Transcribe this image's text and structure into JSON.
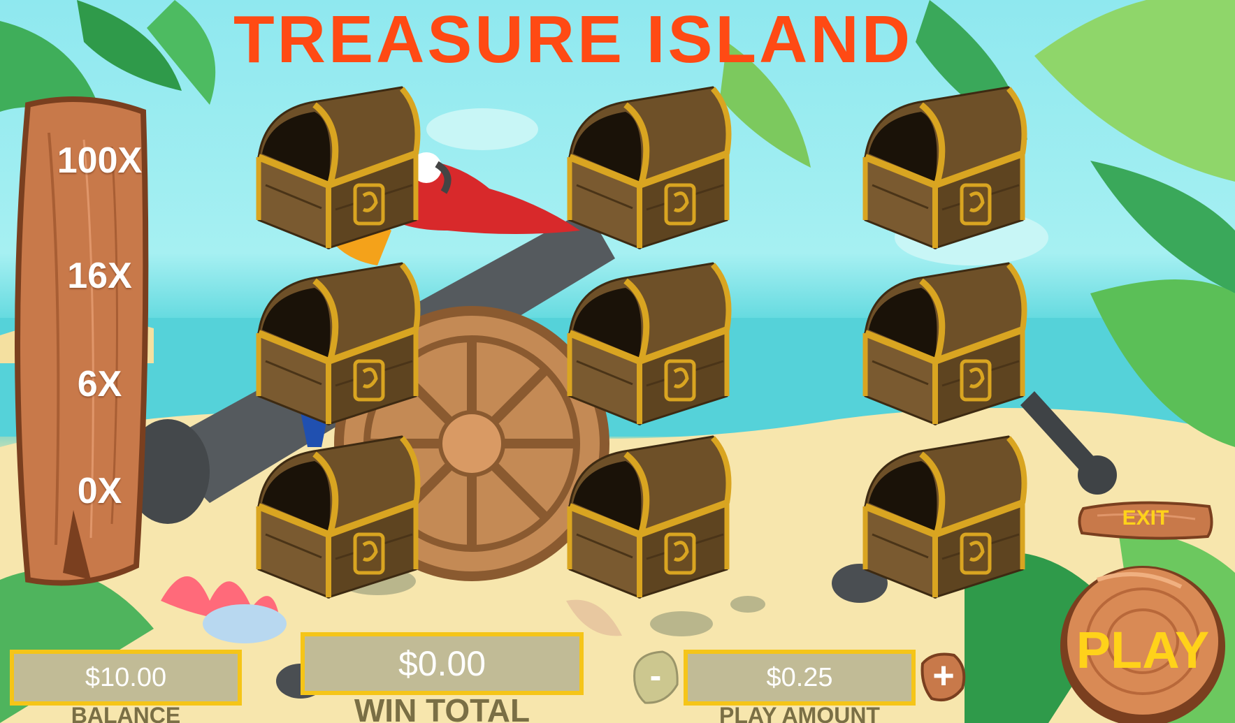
{
  "game": {
    "title": "TREASURE ISLAND"
  },
  "multipliers": [
    "100X",
    "16X",
    "6X",
    "0X"
  ],
  "chests": [
    {
      "id": "chest-1"
    },
    {
      "id": "chest-2"
    },
    {
      "id": "chest-3"
    },
    {
      "id": "chest-4"
    },
    {
      "id": "chest-5"
    },
    {
      "id": "chest-6"
    },
    {
      "id": "chest-7"
    },
    {
      "id": "chest-8"
    },
    {
      "id": "chest-9"
    }
  ],
  "balance": {
    "value": "$10.00",
    "label": "BALANCE"
  },
  "win_total": {
    "value": "$0.00",
    "label": "WIN TOTAL"
  },
  "play_amount": {
    "value": "$0.25",
    "label": "PLAY AMOUNT",
    "decrease_label": "-",
    "increase_label": "+"
  },
  "buttons": {
    "exit_label": "EXIT",
    "play_label": "PLAY"
  },
  "colors": {
    "title": "#ff4a14",
    "panel_fill": "#c1bb96",
    "panel_border": "#f5c518",
    "play_text": "#ffd21a",
    "wood": "#c8794a"
  }
}
